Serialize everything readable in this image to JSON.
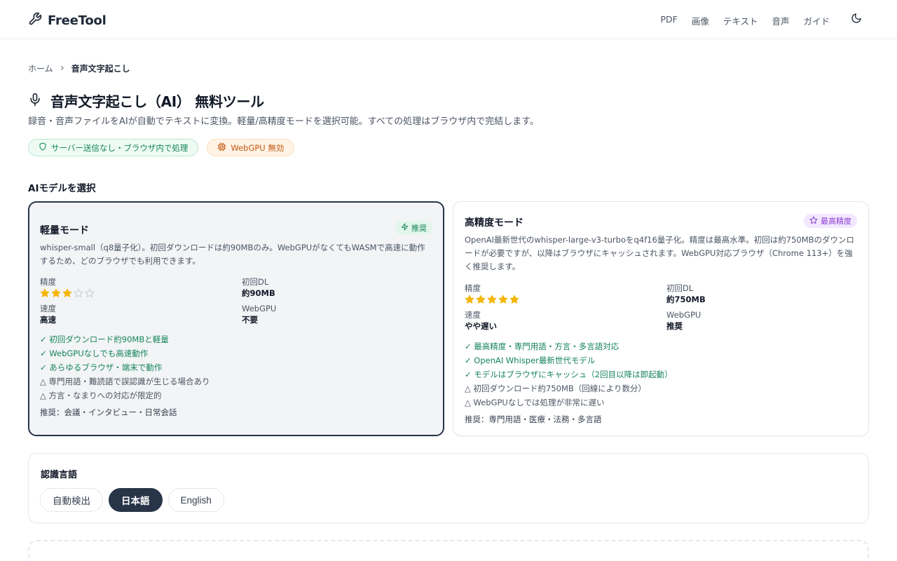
{
  "header": {
    "logo_text": "FreeTool",
    "nav": [
      "PDF",
      "画像",
      "テキスト",
      "音声",
      "ガイド"
    ]
  },
  "breadcrumb": {
    "home": "ホーム",
    "current": "音声文字起こし"
  },
  "page": {
    "title": "音声文字起こし（AI） 無料ツール",
    "subtitle": "録音・音声ファイルをAIが自動でテキストに変換。軽量/高精度モードを選択可能。すべての処理はブラウザ内で完結します。",
    "badge_privacy": "サーバー送信なし・ブラウザ内で処理",
    "badge_webgpu": "WebGPU 無効"
  },
  "model_section": {
    "label": "AIモデルを選択"
  },
  "models": [
    {
      "title": "軽量モード",
      "tag": "推奨",
      "description": "whisper-small（q8量子化）。初回ダウンロードは約90MBのみ。WebGPUがなくてもWASMで高速に動作するため、どのブラウザでも利用できます。",
      "accuracy_label": "精度",
      "accuracy_stars": 3,
      "accuracy_max": 5,
      "dl_label": "初回DL",
      "dl_value": "約90MB",
      "speed_label": "速度",
      "speed_value": "高速",
      "webgpu_label": "WebGPU",
      "webgpu_value": "不要",
      "pros": [
        "✓ 初回ダウンロード約90MBと軽量",
        "✓ WebGPUなしでも高速動作",
        "✓ あらゆるブラウザ・端末で動作"
      ],
      "cons": [
        "△ 専門用語・難読語で誤認識が生じる場合あり",
        "△ 方言・なまりへの対応が限定的"
      ],
      "recommend": "推奨：会議・インタビュー・日常会話",
      "selected": true
    },
    {
      "title": "高精度モード",
      "tag": "最高精度",
      "description": "OpenAI最新世代のwhisper-large-v3-turboをq4f16量子化。精度は最高水準。初回は約750MBのダウンロードが必要ですが、以降はブラウザにキャッシュされます。WebGPU対応ブラウザ（Chrome 113+）を強く推奨します。",
      "accuracy_label": "精度",
      "accuracy_stars": 5,
      "accuracy_max": 5,
      "dl_label": "初回DL",
      "dl_value": "約750MB",
      "speed_label": "速度",
      "speed_value": "やや遅い",
      "webgpu_label": "WebGPU",
      "webgpu_value": "推奨",
      "pros": [
        "✓ 最高精度・専門用語・方言・多言語対応",
        "✓ OpenAI Whisper最新世代モデル",
        "✓ モデルはブラウザにキャッシュ（2回目以降は即起動）"
      ],
      "cons": [
        "△ 初回ダウンロード約750MB（回線により数分）",
        "△ WebGPUなしでは処理が非常に遅い"
      ],
      "recommend": "推奨：専門用語・医療・法務・多言語",
      "selected": false
    }
  ],
  "language": {
    "title": "認識言語",
    "options": [
      "自動検出",
      "日本語",
      "English"
    ],
    "selected": "日本語"
  },
  "colors": {
    "accent_dark": "#283548",
    "green": "#16845a",
    "orange": "#c2570c",
    "purple": "#8b3fd1",
    "star": "#f5b50b"
  }
}
